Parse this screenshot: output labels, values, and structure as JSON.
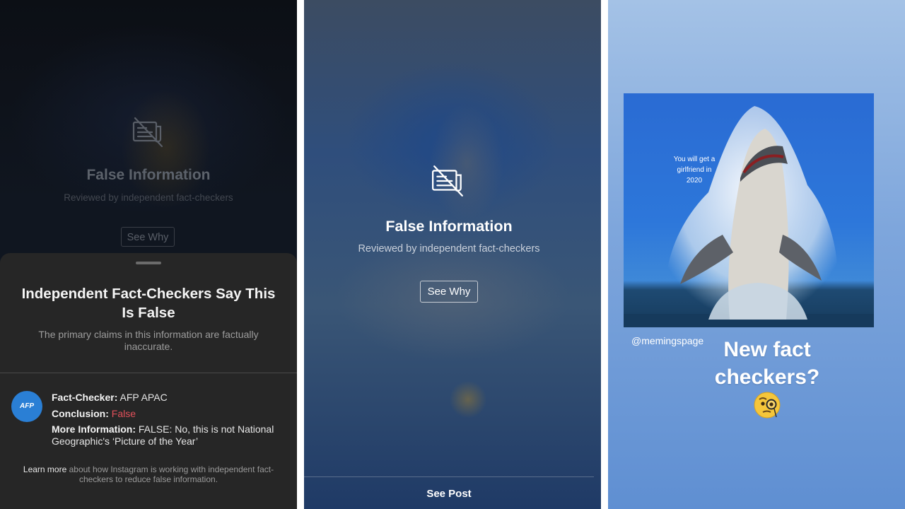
{
  "left": {
    "dimmed_title": "False Information",
    "dimmed_subtitle": "Reviewed by independent fact-checkers",
    "dimmed_button": "See Why",
    "sheet": {
      "title": "Independent Fact-Checkers Say This Is False",
      "description": "The primary claims in this information are factually inaccurate.",
      "fact_checker_label": "Fact-Checker:",
      "fact_checker_value": "AFP APAC",
      "conclusion_label": "Conclusion:",
      "conclusion_value": "False",
      "more_info_label": "More Information:",
      "more_info_value": "FALSE: No, this is not National Geographic's ‘Picture of the Year’",
      "logo_text": "AFP",
      "learn_more_link": "Learn more",
      "learn_more_text": "about how Instagram is working with independent fact-checkers to reduce false information."
    }
  },
  "middle": {
    "title": "False Information",
    "subtitle": "Reviewed by independent fact-checkers",
    "button": "See Why",
    "see_post": "See Post"
  },
  "right": {
    "meme_text": "You will get a girlfriend in 2020",
    "handle": "@memingspage",
    "caption": "New fact checkers?",
    "emoji": "face-with-monocle-icon"
  },
  "colors": {
    "false_red": "#e2505a",
    "afp_blue": "#2a7fd5",
    "sheet_bg": "#262626"
  }
}
